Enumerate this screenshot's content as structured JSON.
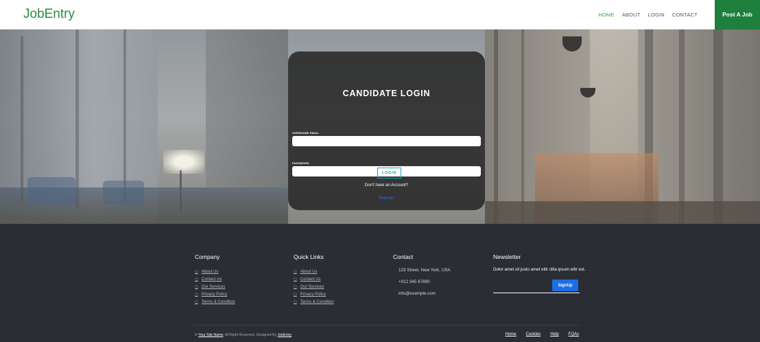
{
  "navbar": {
    "brand": "JobEntry",
    "links": [
      {
        "label": "HOME",
        "active": true
      },
      {
        "label": "ABOUT",
        "active": false
      },
      {
        "label": "LOGIN",
        "active": false
      },
      {
        "label": "CONTACT",
        "active": false
      }
    ],
    "post_job": "Post A Job"
  },
  "login": {
    "title": "CANDIDATE LOGIN",
    "username_label": "USERNAME EMAIL",
    "username_value": "",
    "password_label": "PASSWORD",
    "password_value": "",
    "button": "LOGIN",
    "no_account": "Don't have an Account?",
    "register": "Register"
  },
  "footer": {
    "company": {
      "title": "Company",
      "links": [
        "About Us",
        "Contact Us",
        "Our Services",
        "Privacy Policy",
        "Terms & Condition"
      ]
    },
    "quick_links": {
      "title": "Quick Links",
      "links": [
        "About Us",
        "Contact Us",
        "Our Services",
        "Privacy Policy",
        "Terms & Condition"
      ]
    },
    "contact": {
      "title": "Contact",
      "address": "123 Street, New York, USA",
      "phone": "+012 345 67890",
      "email": "info@example.com"
    },
    "newsletter": {
      "title": "Newsletter",
      "text": "Dolor amet sit justo amet elitr clita ipsum elitr est.",
      "button": "SignUp"
    },
    "copyright": {
      "prefix": "©",
      "site_name": "Your Site Name",
      "middle": ", All Right Reserved. Designed By",
      "designer": "JobEntry"
    },
    "bottom_links": [
      "Home",
      "Cookies",
      "Help",
      "FQAs"
    ]
  },
  "colors": {
    "brand": "#2b8a3e",
    "post_button": "#1f7f3d",
    "footer_bg": "#2a2d33",
    "accent_teal": "#17a2b8",
    "signup_blue": "#1a6fe6"
  }
}
